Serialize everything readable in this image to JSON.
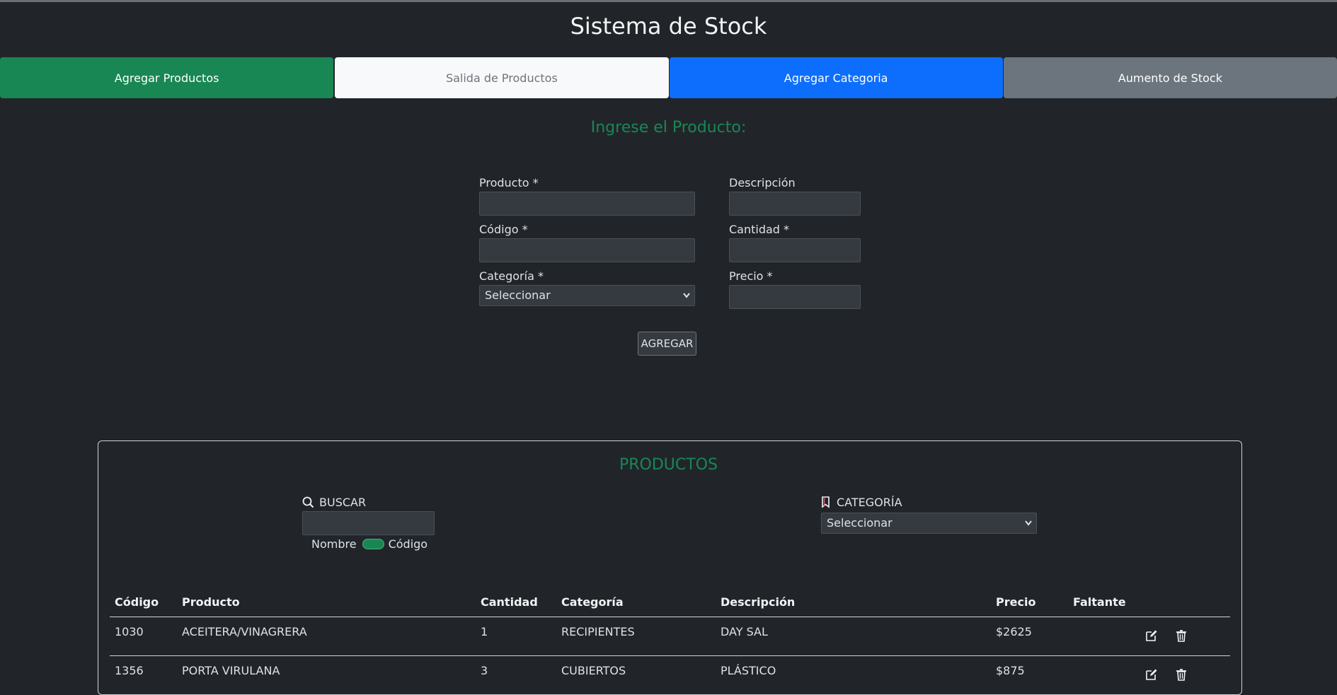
{
  "app": {
    "title": "Sistema de Stock"
  },
  "nav": {
    "add_products": "Agregar Productos",
    "products_out": "Salida de Productos",
    "add_category": "Agregar Categoria",
    "stock_increase": "Aumento de Stock"
  },
  "form": {
    "heading": "Ingrese el Producto:",
    "product_label": "Producto *",
    "code_label": "Código *",
    "category_label": "Categoría *",
    "category_selected": "Seleccionar",
    "description_label": "Descripción",
    "quantity_label": "Cantidad *",
    "price_label": "Precio *",
    "submit_label": "AGREGAR"
  },
  "products_panel": {
    "title": "PRODUCTOS",
    "search_label": "BUSCAR",
    "toggle_left": "Nombre",
    "toggle_right": "Código",
    "category_filter_label": "CATEGORÍA",
    "category_filter_selected": "Seleccionar"
  },
  "table": {
    "columns": [
      "Código",
      "Producto",
      "Cantidad",
      "Categoría",
      "Descripción",
      "Precio",
      "Faltante"
    ],
    "rows": [
      [
        "1030",
        "ACEITERA/VINAGRERA",
        "1",
        "RECIPIENTES",
        "DAY SAL",
        "$2625",
        ""
      ],
      [
        "1356",
        "PORTA VIRULANA",
        "3",
        "CUBIERTOS",
        "PLÁSTICO",
        "$875",
        ""
      ]
    ]
  },
  "icons": {
    "search": "search-icon",
    "bookmark": "bookmark-icon",
    "edit": "edit-icon",
    "delete": "trash-icon",
    "chevron": "chevron-down-icon"
  },
  "colors": {
    "background": "#212529",
    "success": "#198754",
    "primary": "#0d6efd",
    "secondary": "#6c757d",
    "light": "#f8f9fa"
  }
}
